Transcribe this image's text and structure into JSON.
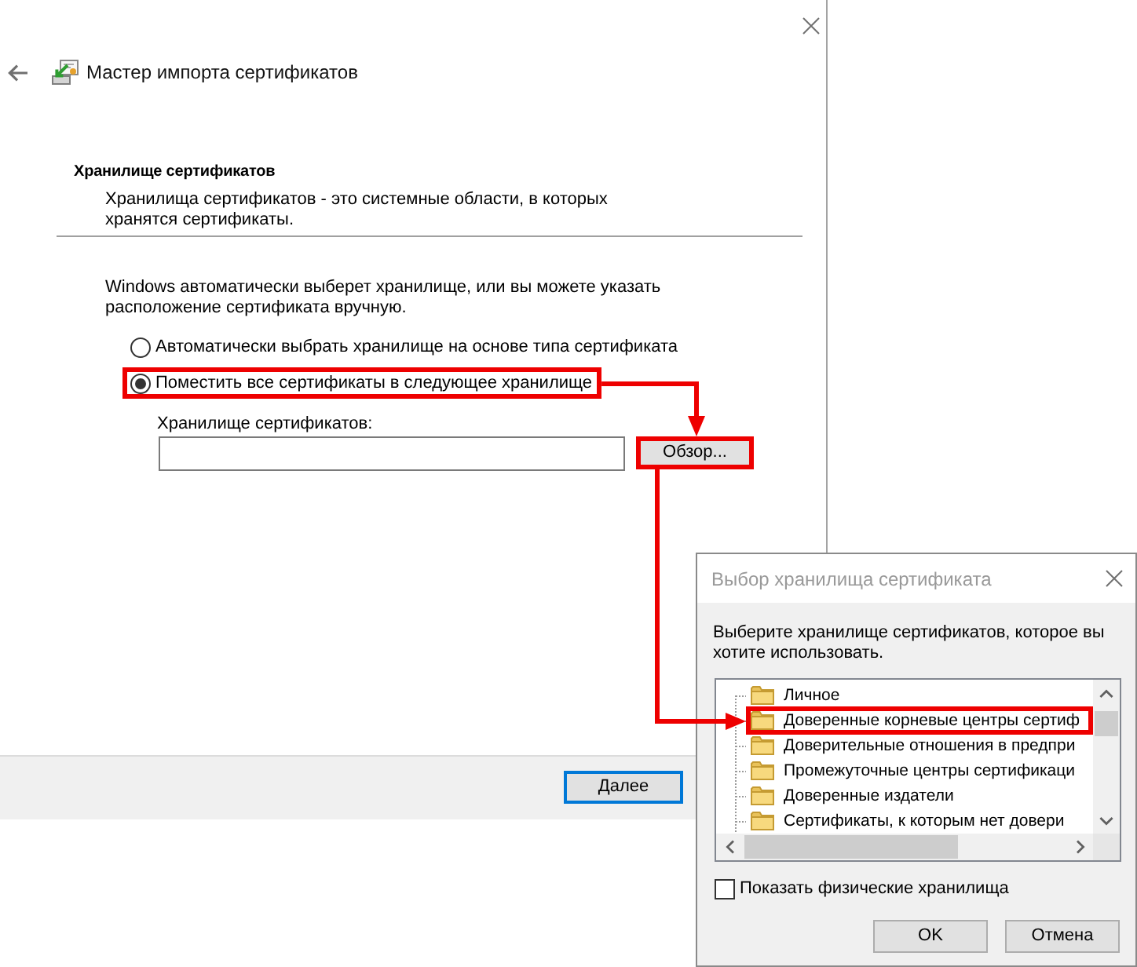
{
  "wizard": {
    "title": "Мастер импорта сертификатов",
    "section": {
      "heading": "Хранилище сертификатов",
      "description": "Хранилища сертификатов - это системные области, в которых хранятся сертификаты."
    },
    "intro": "Windows автоматически выберет хранилище, или вы можете указать расположение сертификата вручную.",
    "options": [
      {
        "label": "Автоматически выбрать хранилище на основе типа сертификата",
        "selected": false,
        "highlighted": false
      },
      {
        "label": "Поместить все сертификаты в следующее хранилище",
        "selected": true,
        "highlighted": true
      }
    ],
    "store_field": {
      "label": "Хранилище сертификатов:"
    },
    "browse_button": {
      "label": "Обзор...",
      "highlighted": true
    },
    "next_button": {
      "label": "Далее",
      "default": true
    }
  },
  "store_dialog": {
    "title": "Выбор хранилища сертификата",
    "prompt": "Выберите хранилище сертификатов, которое вы хотите использовать.",
    "stores": [
      {
        "label": "Личное",
        "selected": false,
        "highlighted": false
      },
      {
        "label": "Доверенные корневые центры сертиф",
        "selected": false,
        "highlighted": true
      },
      {
        "label": "Доверительные отношения в предпри",
        "selected": false,
        "highlighted": false
      },
      {
        "label": "Промежуточные центры сертификаци",
        "selected": false,
        "highlighted": false
      },
      {
        "label": "Доверенные издатели",
        "selected": false,
        "highlighted": false
      },
      {
        "label": "Сертификаты, к которым нет довери",
        "selected": false,
        "highlighted": false
      }
    ],
    "show_physical": {
      "label": "Показать физические хранилища",
      "checked": false
    },
    "buttons": [
      {
        "label": "OK"
      },
      {
        "label": "Отмена"
      }
    ]
  }
}
